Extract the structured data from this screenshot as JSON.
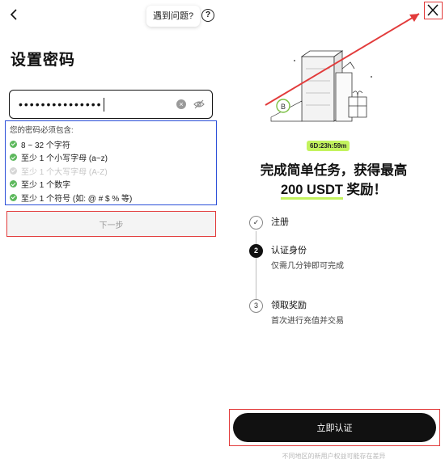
{
  "left": {
    "help_label": "遇到问题?",
    "title": "设置密码",
    "password_value": "•••••••••••••••",
    "rules_header": "您的密码必须包含:",
    "rules": [
      {
        "text": "8 ~ 32 个字符",
        "met": true
      },
      {
        "text": "至少 1 个小写字母 (a~z)",
        "met": true
      },
      {
        "text": "至少 1 个大写字母 (A-Z)",
        "met": false
      },
      {
        "text": "至少 1 个数字",
        "met": true
      },
      {
        "text": "至少 1 个符号 (如: @ # $ % 等)",
        "met": true
      }
    ],
    "next_label": "下一步"
  },
  "right": {
    "timer": "6D:23h:59m",
    "headline_line1": "完成简单任务，获得最高",
    "headline_amount": "200 USDT",
    "headline_suffix": " 奖励！",
    "steps": [
      {
        "num": "✓",
        "title": "注册",
        "desc": ""
      },
      {
        "num": "2",
        "title": "认证身份",
        "desc": "仅需几分钟即可完成"
      },
      {
        "num": "3",
        "title": "领取奖励",
        "desc": "首次进行充值并交易"
      }
    ],
    "verify_label": "立即认证",
    "footnote": "不同地区的新用户权益可能存在差异"
  },
  "colors": {
    "accent_green": "#c3f35e",
    "check_green": "#5cb85c",
    "annotation_red": "#e23b3b",
    "annotation_blue": "#2b4fd8"
  },
  "icons": [
    "back-arrow-icon",
    "help-circle-icon",
    "clear-icon",
    "eye-off-icon",
    "close-icon",
    "check-icon"
  ]
}
